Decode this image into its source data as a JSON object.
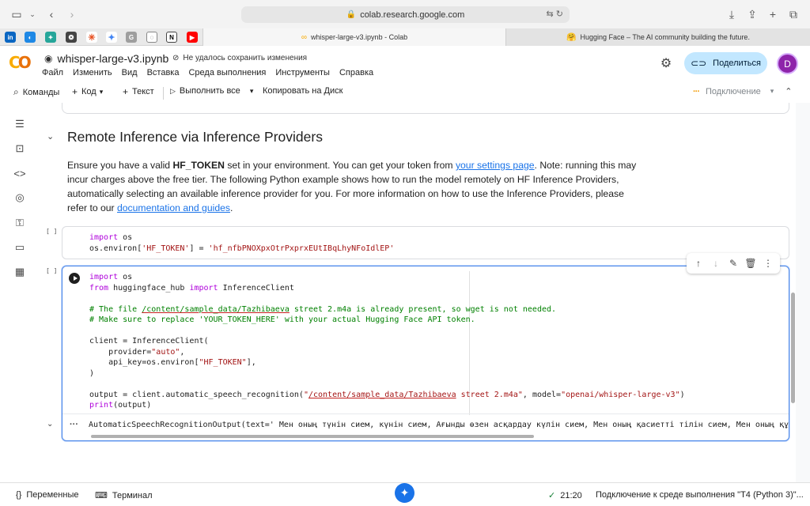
{
  "browser": {
    "url": "colab.research.google.com",
    "tabs": [
      {
        "title": "whisper-large-v3.ipynb - Colab",
        "active": true
      },
      {
        "title": "Hugging Face – The AI community building the future.",
        "active": false
      }
    ],
    "favorites": [
      "linkedin-favicon",
      "compass-favicon",
      "puzzle-favicon",
      "chatgpt-favicon",
      "spark-favicon",
      "sparkle-favicon",
      "g-favicon",
      "search-favicon",
      "notion-favicon",
      "youtube-favicon"
    ]
  },
  "colab": {
    "logo": "CO",
    "title": "whisper-large-v3.ipynb",
    "save_status": "Не удалось сохранить изменения",
    "menu": [
      "Файл",
      "Изменить",
      "Вид",
      "Вставка",
      "Среда выполнения",
      "Инструменты",
      "Справка"
    ],
    "share_label": "Поделиться",
    "avatar_letter": "D",
    "accent_color": "#4a86e8"
  },
  "toolbar": {
    "commands": "Команды",
    "code": "Код",
    "text": "Текст",
    "run_all": "Выполнить все",
    "copy_drive": "Копировать на Диск",
    "connection": "Подключение"
  },
  "section": {
    "heading": "Remote Inference via Inference Providers",
    "p1": "Ensure you have a valid ",
    "token_bold": "HF_TOKEN",
    "p2": " set in your environment. You can get your token from ",
    "link_settings": "your settings page",
    "p3": ". Note: running this may incur charges above the free tier. The following Python example shows how to run the model remotely on HF Inference Providers, automatically selecting an available inference provider for you. For more information on how to use the Inference Providers, please refer to our ",
    "link_docs": "documentation and guides",
    "p4": "."
  },
  "cell1": {
    "bracket": "[ ]",
    "line1_kw": "import",
    "line1_rest": " os",
    "line2_a": "os.environ[",
    "line2_key": "'HF_TOKEN'",
    "line2_b": "] = ",
    "line2_val": "'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'"
  },
  "cell2": {
    "bracket": "[ ]",
    "l1_kw": "import",
    "l1_rest": " os",
    "l2_kw1": "from",
    "l2_mod": " huggingface_hub ",
    "l2_kw2": "import",
    "l2_rest": " InferenceClient",
    "c1_a": "# The file ",
    "c1_path": "/content/sample_data/Tazhibaeva",
    "c1_b": " street 2.m4a is already present, so wget is not needed.",
    "c2": "# Make sure to replace 'YOUR_TOKEN_HERE' with your actual Hugging Face API token.",
    "l3": "client = InferenceClient(",
    "l4_a": "    provider=",
    "l4_val": "\"auto\"",
    "l4_b": ",",
    "l5_a": "    api_key=os.environ[",
    "l5_val": "\"HF_TOKEN\"",
    "l5_b": "],",
    "l6": ")",
    "l7_a": "output = client.automatic_speech_recognition(",
    "l7_q1": "\"",
    "l7_path": "/content/sample_data/Tazhibaeva",
    "l7_rest": " street 2.m4a\"",
    "l7_b": ", model=",
    "l7_model": "\"openai/whisper-large-v3\"",
    "l7_c": ")",
    "l8_kw": "print",
    "l8_rest": "(output)",
    "output": "AutomaticSpeechRecognitionOutput(text=' Мен оның түнін сием, күнін сием, Ағынды өзен асқардау күлін сием, Мен оның қасиетті тілін сием, Мен оның құ"
  },
  "statusbar": {
    "variables": "Переменные",
    "terminal": "Терминал",
    "time": "21:20",
    "connection_msg": "Подключение к среде выполнения \"T4 (Python 3)\"..."
  }
}
